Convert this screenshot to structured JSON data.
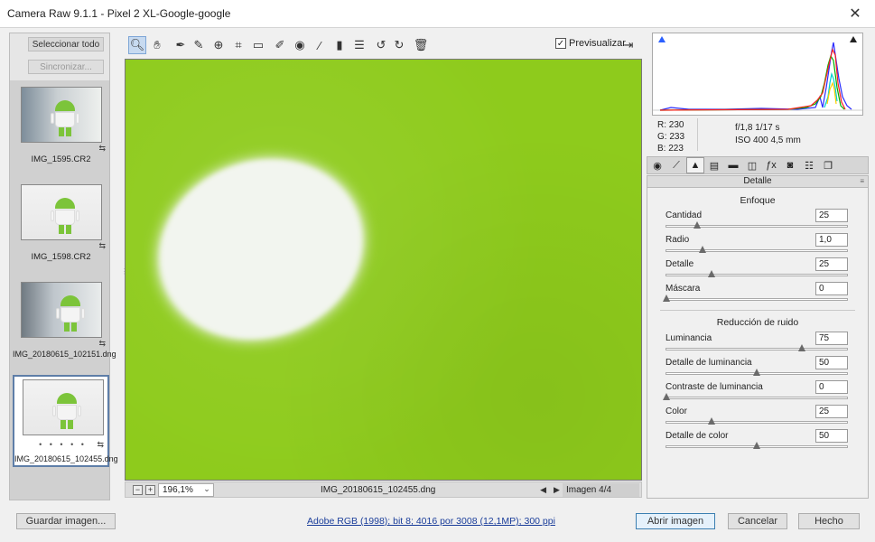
{
  "window": {
    "title": "Camera Raw 9.1.1 -  Pixel 2 XL-Google-google",
    "close_icon": "close-icon"
  },
  "filmstrip": {
    "select_all": "Seleccionar todo",
    "sync": "Sincronizar...",
    "items": [
      {
        "label": "IMG_1595.CR2"
      },
      {
        "label": "IMG_1598.CR2"
      },
      {
        "label": "IMG_20180615_102151.dng"
      },
      {
        "label": "IMG_20180615_102455.dng",
        "rating": "• • • • •",
        "selected": true
      }
    ]
  },
  "toolbar": {
    "tools": [
      "zoom-tool-icon",
      "hand-tool-icon",
      "white-balance-icon",
      "color-sampler-icon",
      "target-adjust-icon",
      "crop-icon",
      "straighten-icon",
      "spot-removal-icon",
      "red-eye-icon",
      "adjustment-brush-icon",
      "graduated-filter-icon",
      "preferences-icon",
      "rotate-left-icon",
      "rotate-right-icon",
      "delete-icon"
    ],
    "preview_label": "Previsualizar",
    "preview_checked": true
  },
  "canvas": {
    "background_color": "#8ecb1c"
  },
  "statusbar": {
    "zoom_value": "196,1%",
    "filename": "IMG_20180615_102455.dng",
    "image_count": "Imagen 4/4"
  },
  "histogram": {
    "r": "R:  230",
    "g": "G:  233",
    "b": "B:  223",
    "aperture_shutter": "f/1,8    1/17 s",
    "iso_focal": "ISO 400    4,5 mm"
  },
  "panel": {
    "title": "Detalle",
    "sharpening": {
      "title": "Enfoque",
      "sliders": [
        {
          "label": "Cantidad",
          "value": "25",
          "pos": 0.17
        },
        {
          "label": "Radio",
          "value": "1,0",
          "pos": 0.2
        },
        {
          "label": "Detalle",
          "value": "25",
          "pos": 0.25
        },
        {
          "label": "Máscara",
          "value": "0",
          "pos": 0.0
        }
      ]
    },
    "noise": {
      "title": "Reducción de ruido",
      "sliders": [
        {
          "label": "Luminancia",
          "value": "75",
          "pos": 0.75
        },
        {
          "label": "Detalle de luminancia",
          "value": "50",
          "pos": 0.5
        },
        {
          "label": "Contraste de luminancia",
          "value": "0",
          "pos": 0.0
        },
        {
          "label": "Color",
          "value": "25",
          "pos": 0.25
        },
        {
          "label": "Detalle de color",
          "value": "50",
          "pos": 0.5
        }
      ]
    }
  },
  "bottom": {
    "save": "Guardar imagen...",
    "info_link": "Adobe RGB (1998); bit 8; 4016 por 3008 (12,1MP); 300 ppi",
    "open": "Abrir imagen",
    "cancel": "Cancelar",
    "done": "Hecho"
  }
}
